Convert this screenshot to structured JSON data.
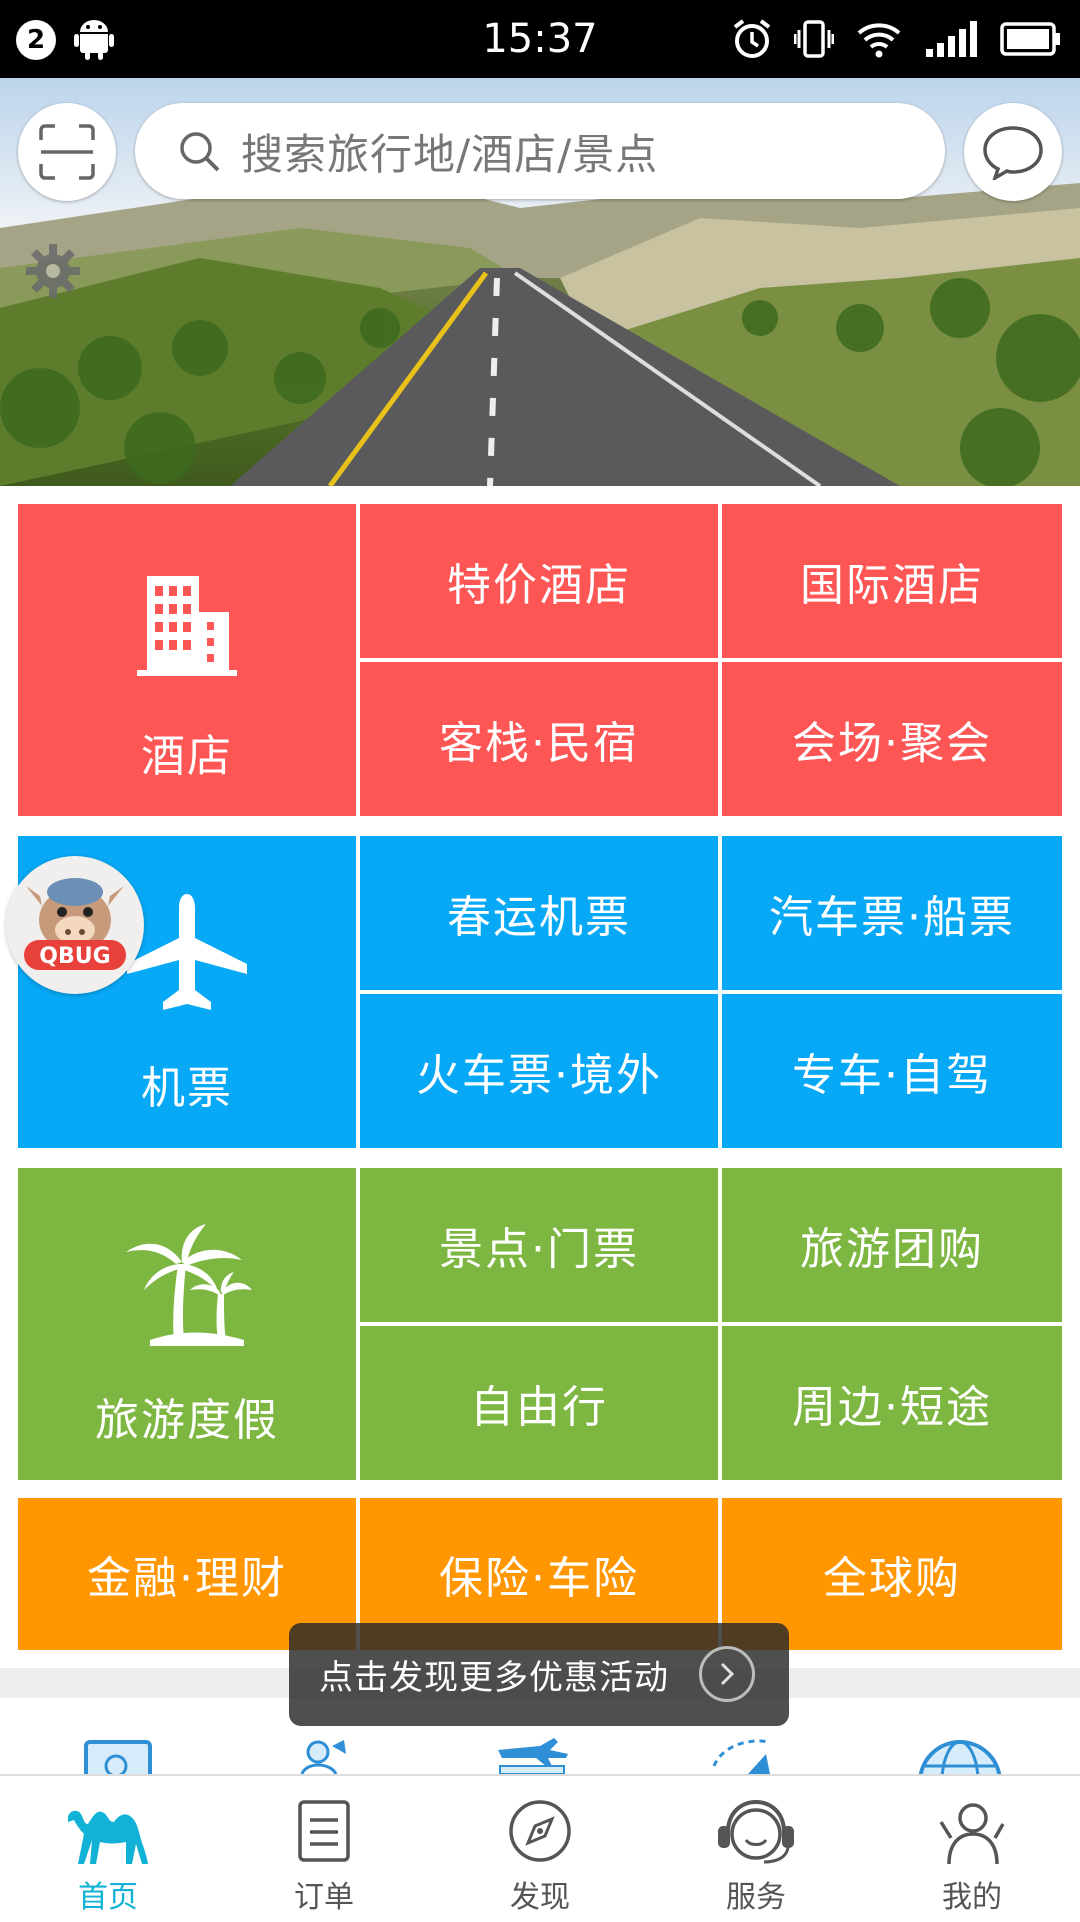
{
  "status_bar": {
    "notification_count": "2",
    "time": "15:37",
    "icons": [
      "android-icon",
      "alarm-icon",
      "vibrate-icon",
      "wifi-icon",
      "signal-icon",
      "battery-icon"
    ]
  },
  "header": {
    "search_placeholder": "搜索旅行地/酒店/景点",
    "scan_icon": "scan-icon",
    "message_icon": "message-icon",
    "settings_icon": "gear-icon"
  },
  "colors": {
    "hotel": "#fe5555",
    "flight": "#07a8f5",
    "travel": "#7db742",
    "finance": "#ff9602",
    "nav_active": "#11b2d6"
  },
  "grid": {
    "hotel": {
      "label": "酒店",
      "icon": "building-icon",
      "items": [
        "特价酒店",
        "国际酒店",
        "客栈·民宿",
        "会场·聚会"
      ]
    },
    "flight": {
      "label": "机票",
      "icon": "airplane-icon",
      "items": [
        "春运机票",
        "汽车票·船票",
        "火车票·境外",
        "专车·自驾"
      ]
    },
    "travel": {
      "label": "旅游度假",
      "icon": "palm-tree-icon",
      "items": [
        "景点·门票",
        "旅游团购",
        "自由行",
        "周边·短途"
      ]
    },
    "finance": {
      "items": [
        "金融·理财",
        "保险·车险",
        "全球购"
      ]
    }
  },
  "qbug": {
    "label": "QBUG"
  },
  "toast": {
    "text": "点击发现更多优惠活动"
  },
  "bottom_nav": [
    {
      "label": "首页",
      "icon": "camel-icon",
      "active": true
    },
    {
      "label": "订单",
      "icon": "order-list-icon",
      "active": false
    },
    {
      "label": "发现",
      "icon": "compass-icon",
      "active": false
    },
    {
      "label": "服务",
      "icon": "headset-icon",
      "active": false
    },
    {
      "label": "我的",
      "icon": "user-icon",
      "active": false
    }
  ]
}
